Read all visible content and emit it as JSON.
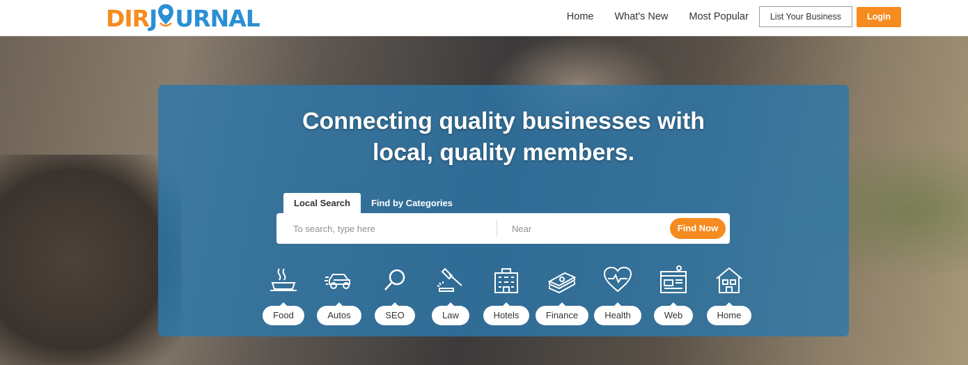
{
  "header": {
    "logo_left": "DIR",
    "logo_right": "J",
    "logo_rest": "URNAL",
    "nav": [
      "Home",
      "What's New",
      "Most Popular"
    ],
    "list_business": "List Your Business",
    "login": "Login"
  },
  "hero": {
    "headline_part1": "Connecting ",
    "headline_bold1": "quality businesses",
    "headline_part2": " with",
    "headline_part3": "local, ",
    "headline_bold2": "quality members."
  },
  "search": {
    "tabs": [
      "Local Search",
      "Find by Categories"
    ],
    "what_placeholder": "To search, type here",
    "near_placeholder": "Near",
    "find_button": "Find Now"
  },
  "categories": [
    {
      "label": "Food",
      "icon": "food-icon"
    },
    {
      "label": "Autos",
      "icon": "car-icon"
    },
    {
      "label": "SEO",
      "icon": "magnifier-icon"
    },
    {
      "label": "Law",
      "icon": "gavel-icon"
    },
    {
      "label": "Hotels",
      "icon": "hotel-icon"
    },
    {
      "label": "Finance",
      "icon": "money-icon"
    },
    {
      "label": "Health",
      "icon": "heart-pulse-icon"
    },
    {
      "label": "Web",
      "icon": "web-design-icon"
    },
    {
      "label": "Home",
      "icon": "house-icon"
    }
  ],
  "colors": {
    "accent": "#f68b1f",
    "brand_blue": "#2a8fd4",
    "panel": "#2d78aa"
  }
}
